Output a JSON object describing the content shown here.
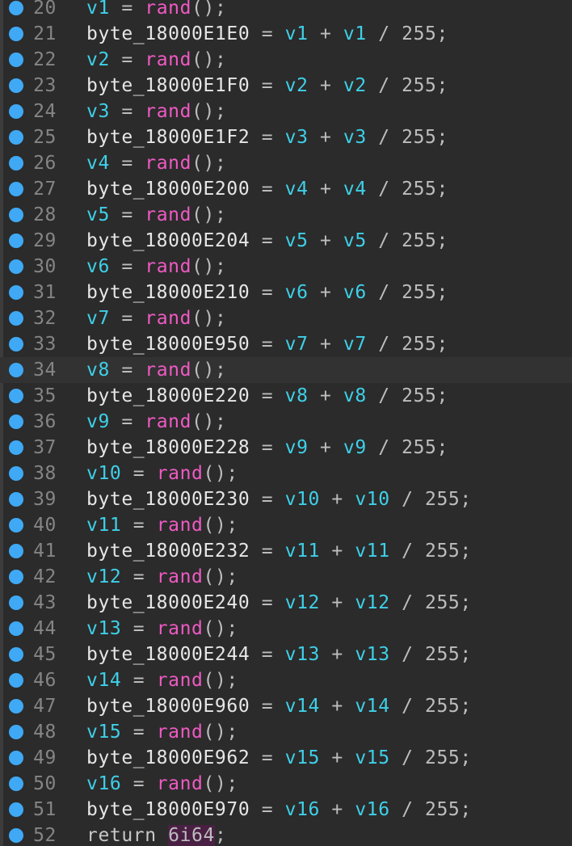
{
  "editor": {
    "lines": [
      {
        "num": "20",
        "kind": "assign",
        "var": "v1",
        "fn": "rand",
        "call": "();"
      },
      {
        "num": "21",
        "kind": "expr",
        "target": "byte_18000E1E0",
        "a": "v1",
        "b": "v1",
        "div": "255;"
      },
      {
        "num": "22",
        "kind": "assign",
        "var": "v2",
        "fn": "rand",
        "call": "();"
      },
      {
        "num": "23",
        "kind": "expr",
        "target": "byte_18000E1F0",
        "a": "v2",
        "b": "v2",
        "div": "255;"
      },
      {
        "num": "24",
        "kind": "assign",
        "var": "v3",
        "fn": "rand",
        "call": "();"
      },
      {
        "num": "25",
        "kind": "expr",
        "target": "byte_18000E1F2",
        "a": "v3",
        "b": "v3",
        "div": "255;"
      },
      {
        "num": "26",
        "kind": "assign",
        "var": "v4",
        "fn": "rand",
        "call": "();"
      },
      {
        "num": "27",
        "kind": "expr",
        "target": "byte_18000E200",
        "a": "v4",
        "b": "v4",
        "div": "255;"
      },
      {
        "num": "28",
        "kind": "assign",
        "var": "v5",
        "fn": "rand",
        "call": "();"
      },
      {
        "num": "29",
        "kind": "expr",
        "target": "byte_18000E204",
        "a": "v5",
        "b": "v5",
        "div": "255;"
      },
      {
        "num": "30",
        "kind": "assign",
        "var": "v6",
        "fn": "rand",
        "call": "();"
      },
      {
        "num": "31",
        "kind": "expr",
        "target": "byte_18000E210",
        "a": "v6",
        "b": "v6",
        "div": "255;"
      },
      {
        "num": "32",
        "kind": "assign",
        "var": "v7",
        "fn": "rand",
        "call": "();"
      },
      {
        "num": "33",
        "kind": "expr",
        "target": "byte_18000E950",
        "a": "v7",
        "b": "v7",
        "div": "255;"
      },
      {
        "num": "34",
        "kind": "assign",
        "var": "v8",
        "fn": "rand",
        "call": "();",
        "current": true
      },
      {
        "num": "35",
        "kind": "expr",
        "target": "byte_18000E220",
        "a": "v8",
        "b": "v8",
        "div": "255;"
      },
      {
        "num": "36",
        "kind": "assign",
        "var": "v9",
        "fn": "rand",
        "call": "();"
      },
      {
        "num": "37",
        "kind": "expr",
        "target": "byte_18000E228",
        "a": "v9",
        "b": "v9",
        "div": "255;"
      },
      {
        "num": "38",
        "kind": "assign",
        "var": "v10",
        "fn": "rand",
        "call": "();"
      },
      {
        "num": "39",
        "kind": "expr",
        "target": "byte_18000E230",
        "a": "v10",
        "b": "v10",
        "div": "255;"
      },
      {
        "num": "40",
        "kind": "assign",
        "var": "v11",
        "fn": "rand",
        "call": "();"
      },
      {
        "num": "41",
        "kind": "expr",
        "target": "byte_18000E232",
        "a": "v11",
        "b": "v11",
        "div": "255;"
      },
      {
        "num": "42",
        "kind": "assign",
        "var": "v12",
        "fn": "rand",
        "call": "();"
      },
      {
        "num": "43",
        "kind": "expr",
        "target": "byte_18000E240",
        "a": "v12",
        "b": "v12",
        "div": "255;"
      },
      {
        "num": "44",
        "kind": "assign",
        "var": "v13",
        "fn": "rand",
        "call": "();"
      },
      {
        "num": "45",
        "kind": "expr",
        "target": "byte_18000E244",
        "a": "v13",
        "b": "v13",
        "div": "255;"
      },
      {
        "num": "46",
        "kind": "assign",
        "var": "v14",
        "fn": "rand",
        "call": "();"
      },
      {
        "num": "47",
        "kind": "expr",
        "target": "byte_18000E960",
        "a": "v14",
        "b": "v14",
        "div": "255;"
      },
      {
        "num": "48",
        "kind": "assign",
        "var": "v15",
        "fn": "rand",
        "call": "();"
      },
      {
        "num": "49",
        "kind": "expr",
        "target": "byte_18000E962",
        "a": "v15",
        "b": "v15",
        "div": "255;"
      },
      {
        "num": "50",
        "kind": "assign",
        "var": "v16",
        "fn": "rand",
        "call": "();"
      },
      {
        "num": "51",
        "kind": "expr",
        "target": "byte_18000E970",
        "a": "v16",
        "b": "v16",
        "div": "255;"
      },
      {
        "num": "52",
        "kind": "return",
        "keyword": "return",
        "value": "6i64",
        "end": ";"
      }
    ],
    "ops": {
      "assign": "=",
      "plus": "+",
      "div": "/"
    },
    "colors": {
      "background": "#2b2b2b",
      "breakpoint": "#3fa9f5",
      "variable": "#3ed0e8",
      "function": "#ef5ac3",
      "line_number": "#858585",
      "current_line": "#323232",
      "return_value_highlight": "#4a1f44"
    },
    "icons": {
      "breakpoint": "breakpoint-dot-icon"
    }
  }
}
